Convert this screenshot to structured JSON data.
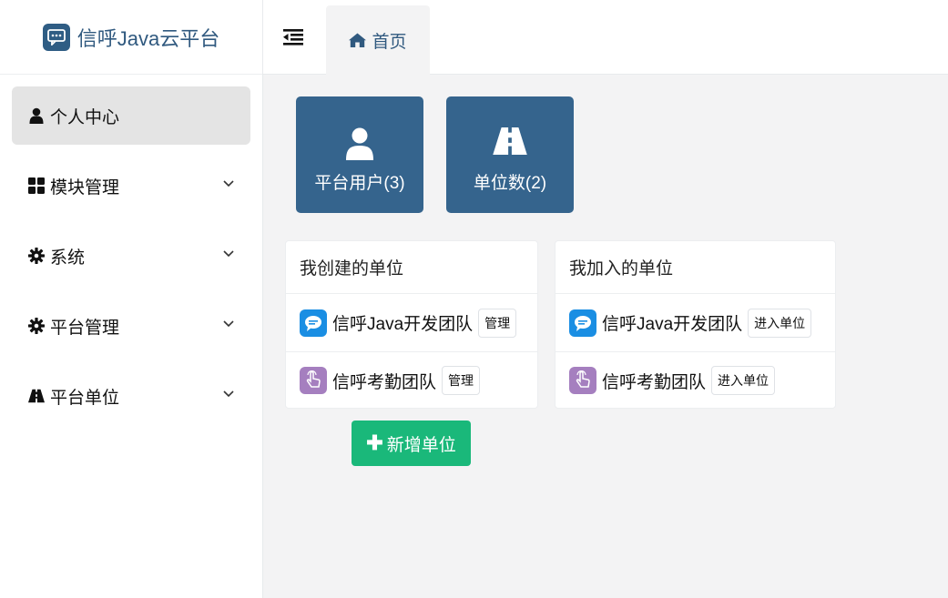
{
  "app": {
    "title": "信呼Java云平台"
  },
  "sidebar": {
    "items": [
      {
        "label": "个人中心",
        "icon": "user-icon",
        "active": true
      },
      {
        "label": "模块管理",
        "icon": "grid-icon"
      },
      {
        "label": "系统",
        "icon": "gear-icon"
      },
      {
        "label": "平台管理",
        "icon": "gear-icon"
      },
      {
        "label": "平台单位",
        "icon": "road-icon"
      }
    ]
  },
  "tabs": [
    {
      "label": "首页",
      "icon": "home-icon"
    }
  ],
  "stats": [
    {
      "label": "平台用户(3)",
      "icon": "user-icon"
    },
    {
      "label": "单位数(2)",
      "icon": "road-icon"
    }
  ],
  "created_panel": {
    "title": "我创建的单位",
    "rows": [
      {
        "name": "信呼Java开发团队",
        "action": "管理",
        "icon": "chat-bubble-icon"
      },
      {
        "name": "信呼考勤团队",
        "action": "管理",
        "icon": "touch-hand-icon"
      }
    ]
  },
  "joined_panel": {
    "title": "我加入的单位",
    "rows": [
      {
        "name": "信呼Java开发团队",
        "action": "进入单位",
        "icon": "chat-bubble-icon"
      },
      {
        "name": "信呼考勤团队",
        "action": "进入单位",
        "icon": "touch-hand-icon"
      }
    ]
  },
  "add_button": {
    "label": "新增单位",
    "icon": "plus-icon"
  },
  "colors": {
    "brand": "#30597f",
    "stat_bg": "#35648d",
    "add_green": "#1ab87a",
    "chat_blue": "#1a8ee3",
    "hand_purple": "#a57fbf"
  }
}
